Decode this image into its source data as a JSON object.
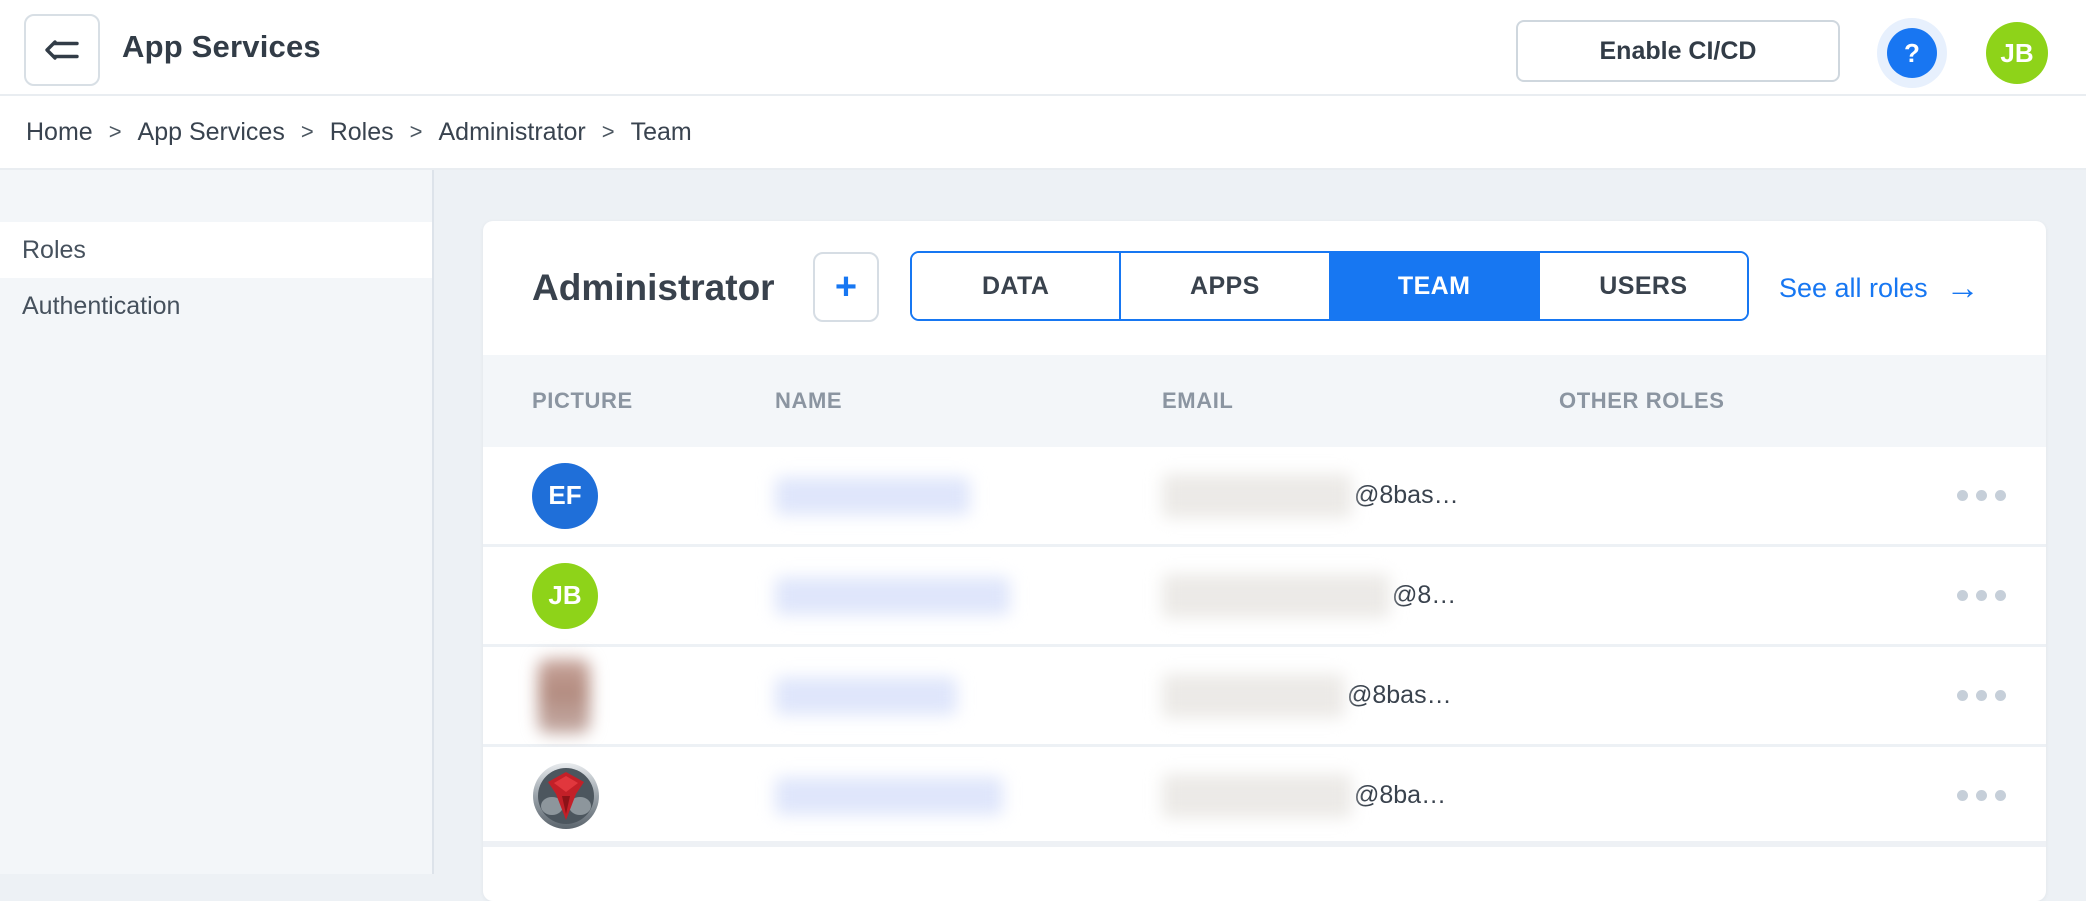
{
  "app": {
    "title": "App Services"
  },
  "header": {
    "enable_cicd_button": "Enable CI/CD",
    "help_glyph": "?",
    "user_avatar_initials": "JB"
  },
  "breadcrumb": {
    "separator": ">",
    "items": [
      "Home",
      "App Services",
      "Roles",
      "Administrator",
      "Team"
    ]
  },
  "sidebar": {
    "items": [
      {
        "label": "Roles",
        "active": true
      },
      {
        "label": "Authentication",
        "active": false
      }
    ]
  },
  "main": {
    "role_title": "Administrator",
    "add_role_button": "+",
    "tabs": [
      {
        "label": "DATA",
        "active": false
      },
      {
        "label": "APPS",
        "active": false
      },
      {
        "label": "TEAM",
        "active": true
      },
      {
        "label": "USERS",
        "active": false
      }
    ],
    "see_all_roles": {
      "label": "See all roles",
      "arrow": "→"
    },
    "team_table": {
      "columns": [
        "PICTURE",
        "NAME",
        "EMAIL",
        "OTHER ROLES"
      ],
      "rows": [
        {
          "avatar": {
            "type": "initials",
            "initials": "EF",
            "color": "#1f6fd9"
          },
          "name_blurred": true,
          "email_blurred": true,
          "email_suffix": "@8bas…",
          "other_roles": ""
        },
        {
          "avatar": {
            "type": "initials",
            "initials": "JB",
            "color": "#8ed319"
          },
          "name_blurred": true,
          "email_blurred": true,
          "email_suffix": "@8…",
          "other_roles": ""
        },
        {
          "avatar": {
            "type": "blurred-photo"
          },
          "name_blurred": true,
          "email_blurred": true,
          "email_suffix": "@8bas…",
          "other_roles": ""
        },
        {
          "avatar": {
            "type": "emblem-logo"
          },
          "name_blurred": true,
          "email_blurred": true,
          "email_suffix": "@8ba…",
          "other_roles": ""
        }
      ]
    }
  },
  "colors": {
    "accent_blue": "#1777f2",
    "avatar_blue": "#1f6fd9",
    "avatar_green": "#8ed319",
    "help_blue": "#1876f2",
    "page_background": "#edf1f5",
    "sidebar_background": "#f3f6f9",
    "table_head_background": "#f3f6f9",
    "table_head_text": "#8b95a1",
    "dark_text": "#323c47",
    "link_blue": "#1777f2"
  }
}
